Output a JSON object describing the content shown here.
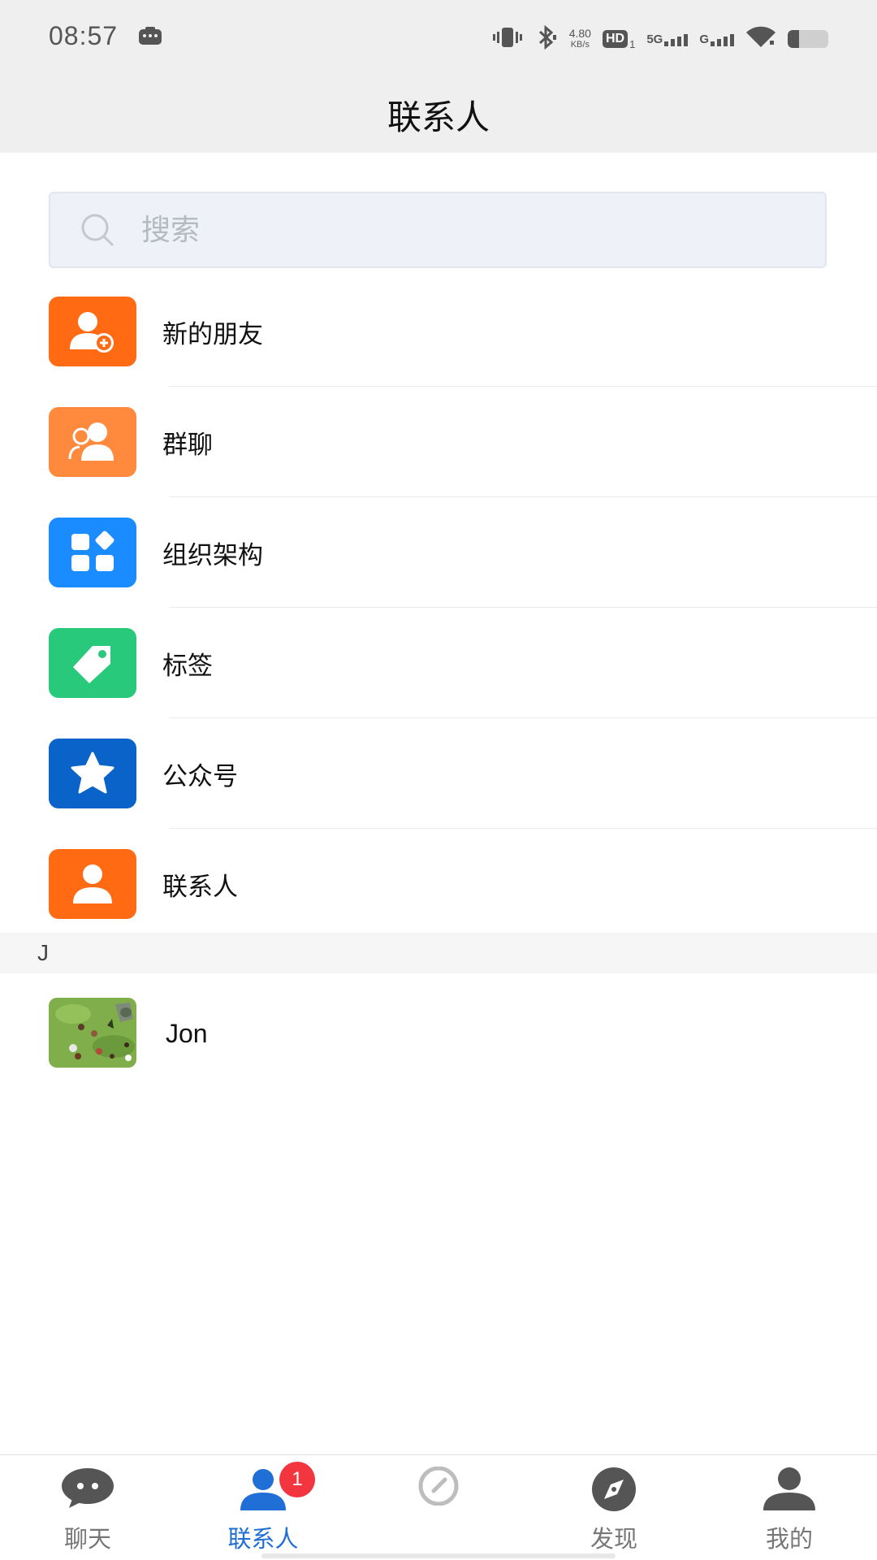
{
  "status_bar": {
    "time": "08:57",
    "speed_value": "4.80",
    "speed_unit": "KB/s",
    "hd": "HD",
    "hd_sub": "1",
    "net1": "5G",
    "net2": "G"
  },
  "header": {
    "title": "联系人"
  },
  "search": {
    "placeholder": "搜索"
  },
  "menu": {
    "items": [
      {
        "label": "新的朋友",
        "color": "#ff6a13",
        "icon": "add-friend-icon"
      },
      {
        "label": "群聊",
        "color": "#ff8a3d",
        "icon": "group-icon"
      },
      {
        "label": "组织架构",
        "color": "#1a8cff",
        "icon": "org-structure-icon"
      },
      {
        "label": "标签",
        "color": "#28c97b",
        "icon": "tag-icon"
      },
      {
        "label": "公众号",
        "color": "#0a63c9",
        "icon": "star-icon"
      },
      {
        "label": "联系人",
        "color": "#ff6a13",
        "icon": "contact-icon"
      }
    ]
  },
  "section": {
    "letter": "J"
  },
  "contacts": [
    {
      "name": "Jon",
      "avatar": "game-scene-avatar"
    }
  ],
  "bottom_nav": {
    "items": [
      {
        "label": "聊天",
        "icon": "chat-icon",
        "active": false
      },
      {
        "label": "联系人",
        "icon": "contacts-icon",
        "active": true,
        "badge": "1"
      },
      {
        "label": "",
        "icon": "dashboard-icon",
        "active": false
      },
      {
        "label": "发现",
        "icon": "compass-icon",
        "active": false
      },
      {
        "label": "我的",
        "icon": "profile-icon",
        "active": false
      }
    ]
  },
  "colors": {
    "accent": "#1f6fd6",
    "badge": "#f2353e",
    "header_bg": "#efefef"
  }
}
